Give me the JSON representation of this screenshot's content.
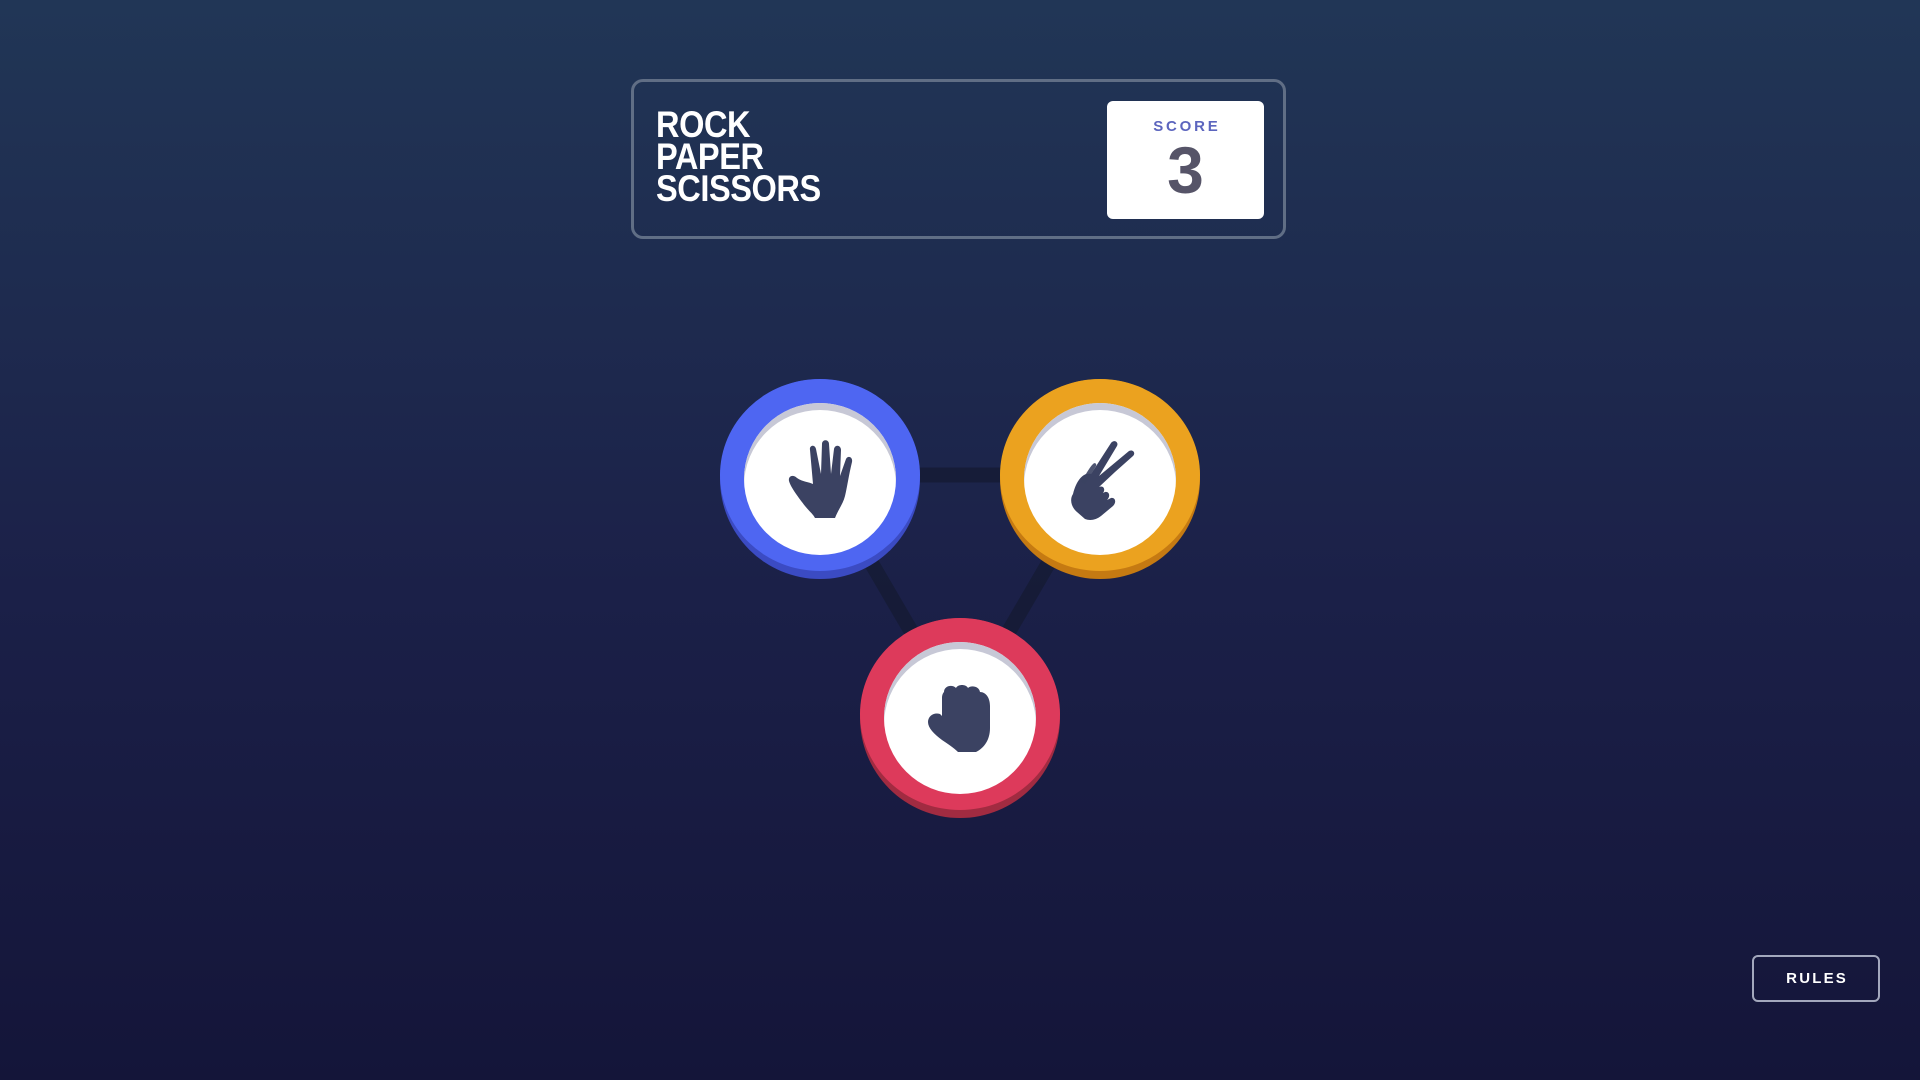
{
  "header": {
    "title_lines": [
      "ROCK",
      "PAPER",
      "SCISSORS"
    ],
    "score_label": "SCORE",
    "score_value": "3"
  },
  "choices": [
    {
      "name": "paper",
      "ring_color": "#4e66f2",
      "ring_shadow_color": "#3b4bc3",
      "icon": "open-hand-icon"
    },
    {
      "name": "scissors",
      "ring_color": "#eba21f",
      "ring_shadow_color": "#c57a12",
      "icon": "scissors-hand-icon"
    },
    {
      "name": "rock",
      "ring_color": "#dd3a5b",
      "ring_shadow_color": "#a12b41",
      "icon": "fist-icon"
    }
  ],
  "rules_button": {
    "label": "RULES"
  },
  "colors": {
    "background_top": "#213656",
    "background_bottom": "#141539",
    "header_border": "#606e85",
    "score_label": "#5c65be",
    "score_value": "#565468",
    "icon_fill": "#3b4262",
    "triangle_line": "#151b35"
  }
}
